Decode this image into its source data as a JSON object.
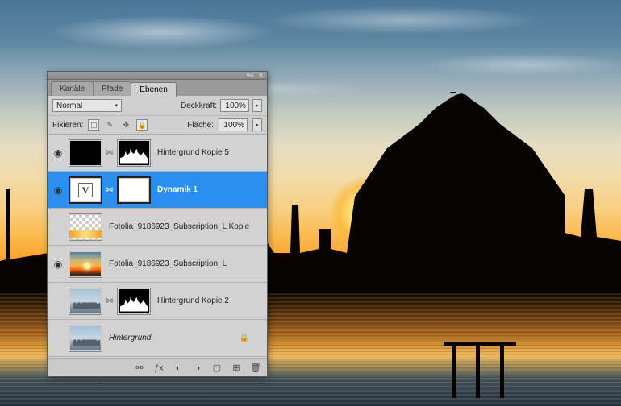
{
  "tabs": {
    "channels": "Kanäle",
    "paths": "Pfade",
    "layers": "Ebenen"
  },
  "blend": {
    "mode": "Normal",
    "opacity_label": "Deckkraft:",
    "opacity_value": "100%"
  },
  "lock": {
    "label": "Fixieren:",
    "fill_label": "Fläche:",
    "fill_value": "100%"
  },
  "layers": [
    {
      "name": "Hintergrund Kopie 5",
      "visible": true
    },
    {
      "name": "Dynamik 1",
      "visible": true,
      "selected": true
    },
    {
      "name": "Fotolia_9186923_Subscription_L Kopie",
      "visible": false
    },
    {
      "name": "Fotolia_9186923_Subscription_L",
      "visible": true
    },
    {
      "name": "Hintergrund Kopie 2",
      "visible": false
    },
    {
      "name": "Hintergrund",
      "italic": true,
      "locked": true,
      "visible": false
    }
  ],
  "icons": {
    "eye": "◉",
    "link": "⋈",
    "lock": "🔒"
  }
}
